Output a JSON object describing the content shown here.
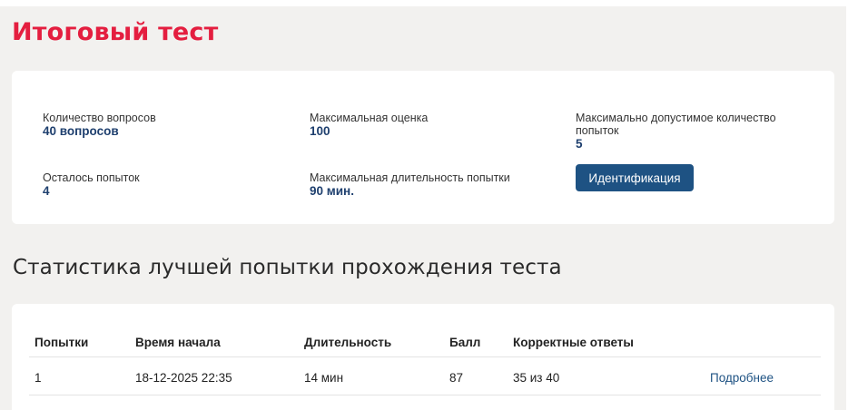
{
  "page": {
    "title": "Итоговый тест"
  },
  "info": {
    "questions": {
      "label": "Количество вопросов",
      "value": "40 вопросов"
    },
    "max_score": {
      "label": "Максимальная оценка",
      "value": "100"
    },
    "max_attempts": {
      "label_line1": "Максимально допустимое количество",
      "label_line2": "попыток",
      "value": "5"
    },
    "remaining": {
      "label": "Осталось попыток",
      "value": "4"
    },
    "max_duration": {
      "label": "Максимальная длительность попытки",
      "value": "90 мин."
    },
    "ident_button": "Идентификация"
  },
  "stats": {
    "title": "Статистика лучшей попытки прохождения теста",
    "headers": [
      "Попытки",
      "Время начала",
      "Длительность",
      "Балл",
      "Корректные ответы"
    ],
    "rows": [
      {
        "attempt": "1",
        "start": "18-12-2025 22:35",
        "duration": "14 мин",
        "score": "87",
        "correct": "35 из 40",
        "details": "Подробнее"
      }
    ]
  }
}
